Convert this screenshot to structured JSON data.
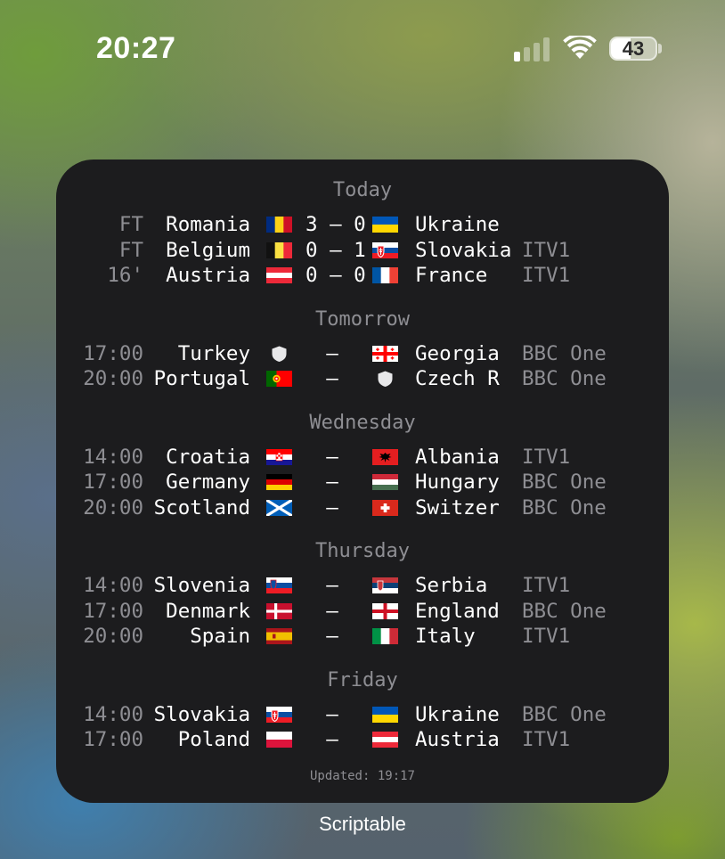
{
  "status_bar": {
    "time": "20:27",
    "battery_level": "43",
    "battery_fraction": 0.43,
    "signal_bars_active": 1,
    "signal_bars_total": 4
  },
  "widget": {
    "name": "Scriptable",
    "updated": "Updated: 19:17",
    "days": [
      {
        "label": "Today",
        "matches": [
          {
            "time": "FT",
            "home": "Romania",
            "home_flag": "romania",
            "score": "3 – 0",
            "away": "Ukraine",
            "away_flag": "ukraine",
            "channel": ""
          },
          {
            "time": "FT",
            "home": "Belgium",
            "home_flag": "belgium",
            "score": "0 – 1",
            "away": "Slovakia",
            "away_flag": "slovakia",
            "channel": "ITV1"
          },
          {
            "time": "16'",
            "home": "Austria",
            "home_flag": "austria",
            "score": "0 – 0",
            "away": "France",
            "away_flag": "france",
            "channel": "ITV1"
          }
        ]
      },
      {
        "label": "Tomorrow",
        "matches": [
          {
            "time": "17:00",
            "home": "Turkey",
            "home_flag": "shield",
            "score": "–",
            "away": "Georgia",
            "away_flag": "georgia",
            "channel": "BBC One"
          },
          {
            "time": "20:00",
            "home": "Portugal",
            "home_flag": "portugal",
            "score": "–",
            "away": "Czech R",
            "away_flag": "shield",
            "channel": "BBC One"
          }
        ]
      },
      {
        "label": "Wednesday",
        "matches": [
          {
            "time": "14:00",
            "home": "Croatia",
            "home_flag": "croatia",
            "score": "–",
            "away": "Albania",
            "away_flag": "albania",
            "channel": "ITV1"
          },
          {
            "time": "17:00",
            "home": "Germany",
            "home_flag": "germany",
            "score": "–",
            "away": "Hungary",
            "away_flag": "hungary",
            "channel": "BBC One"
          },
          {
            "time": "20:00",
            "home": "Scotland",
            "home_flag": "scotland",
            "score": "–",
            "away": "Switzer",
            "away_flag": "switzerland",
            "channel": "BBC One"
          }
        ]
      },
      {
        "label": "Thursday",
        "matches": [
          {
            "time": "14:00",
            "home": "Slovenia",
            "home_flag": "slovenia",
            "score": "–",
            "away": "Serbia",
            "away_flag": "serbia",
            "channel": "ITV1"
          },
          {
            "time": "17:00",
            "home": "Denmark",
            "home_flag": "denmark",
            "score": "–",
            "away": "England",
            "away_flag": "england",
            "channel": "BBC One"
          },
          {
            "time": "20:00",
            "home": "Spain",
            "home_flag": "spain",
            "score": "–",
            "away": "Italy",
            "away_flag": "italy",
            "channel": "ITV1"
          }
        ]
      },
      {
        "label": "Friday",
        "matches": [
          {
            "time": "14:00",
            "home": "Slovakia",
            "home_flag": "slovakia",
            "score": "–",
            "away": "Ukraine",
            "away_flag": "ukraine",
            "channel": "BBC One"
          },
          {
            "time": "17:00",
            "home": "Poland",
            "home_flag": "poland",
            "score": "–",
            "away": "Austria",
            "away_flag": "austria",
            "channel": "ITV1"
          }
        ]
      }
    ]
  }
}
